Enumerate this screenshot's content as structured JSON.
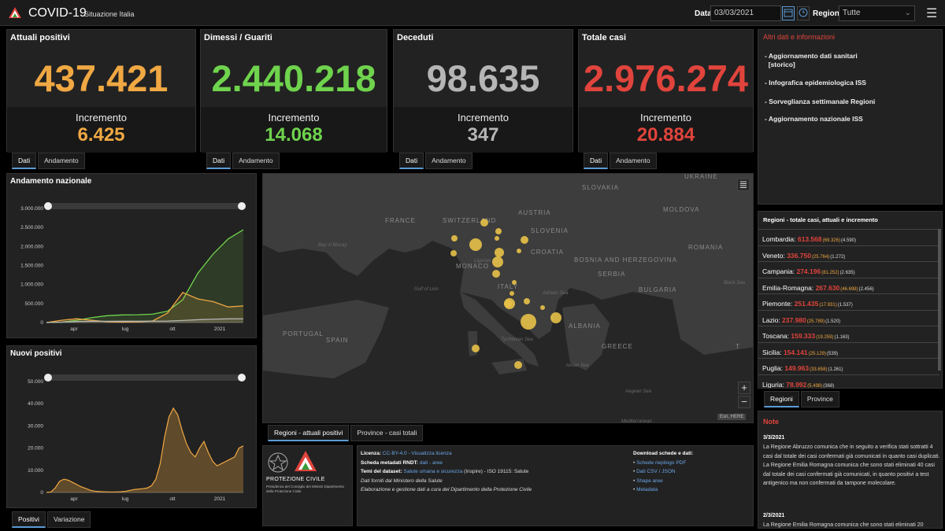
{
  "header": {
    "title": "COVID-19",
    "subtitle": "Situazione Italia",
    "date_label": "Data",
    "date_value": "03/03/2021",
    "region_label": "Regione",
    "region_value": "Tutte"
  },
  "kpis": [
    {
      "title": "Attuali positivi",
      "value": "437.421",
      "inc_label": "Incremento",
      "inc_value": "6.425",
      "color": "#f0a843"
    },
    {
      "title": "Dimessi / Guariti",
      "value": "2.440.218",
      "inc_label": "Incremento",
      "inc_value": "14.068",
      "color": "#6fd34d"
    },
    {
      "title": "Deceduti",
      "value": "98.635",
      "inc_label": "Incremento",
      "inc_value": "347",
      "color": "#b5b5b5"
    },
    {
      "title": "Totale casi",
      "value": "2.976.274",
      "inc_label": "Incremento",
      "inc_value": "20.884",
      "color": "#e0443c"
    }
  ],
  "kpi_tabs": {
    "dati": "Dati",
    "andamento": "Andamento"
  },
  "chart_nazionale": {
    "title": "Andamento nazionale",
    "yticks": [
      "3.000.000",
      "2.500.000",
      "2.000.000",
      "1.500.000",
      "1.000.000",
      "500.000",
      "0"
    ],
    "xticks": [
      "apr",
      "lug",
      "ott",
      "2021"
    ]
  },
  "chart_nuovi": {
    "title": "Nuovi positivi",
    "yticks": [
      "50.000",
      "40.000",
      "30.000",
      "20.000",
      "10.000",
      "0"
    ],
    "xticks": [
      "apr",
      "lug",
      "ott",
      "2021"
    ],
    "tabs": [
      "Positivi",
      "Variazione"
    ]
  },
  "chart_data": [
    {
      "type": "line",
      "title": "Andamento nazionale",
      "x": [
        "2020-02",
        "2020-03",
        "2020-04",
        "2020-05",
        "2020-06",
        "2020-07",
        "2020-08",
        "2020-09",
        "2020-10",
        "2020-11",
        "2020-12",
        "2021-01",
        "2021-02",
        "2021-03"
      ],
      "series": [
        {
          "color": "#6fd34d",
          "values": [
            0,
            10000,
            60000,
            130000,
            180000,
            200000,
            205000,
            220000,
            300000,
            600000,
            1300000,
            1800000,
            2200000,
            2440218
          ]
        },
        {
          "color": "#f0a843",
          "values": [
            0,
            60000,
            100000,
            60000,
            20000,
            12000,
            15000,
            40000,
            250000,
            790000,
            620000,
            550000,
            410000,
            437421
          ]
        },
        {
          "color": "#b5b5b5",
          "values": [
            0,
            10000,
            28000,
            33000,
            34000,
            35000,
            35500,
            36000,
            39000,
            55000,
            74000,
            88000,
            97000,
            98635
          ]
        }
      ],
      "ylim": [
        0,
        3000000
      ],
      "xticks": [
        "apr",
        "lug",
        "ott",
        "2021"
      ]
    },
    {
      "type": "area",
      "title": "Nuovi positivi",
      "color": "#f0a843",
      "values": [
        0,
        200,
        2000,
        5000,
        6000,
        5500,
        4500,
        3500,
        2500,
        1800,
        1000,
        600,
        400,
        300,
        250,
        200,
        250,
        300,
        500,
        900,
        1300,
        1500,
        1700,
        2000,
        3000,
        6000,
        13000,
        25000,
        34000,
        38000,
        35000,
        28000,
        22000,
        18000,
        16000,
        20000,
        23000,
        18000,
        14000,
        12000,
        13000,
        14000,
        15000,
        16000,
        20000,
        21000
      ],
      "ylim": [
        0,
        50000
      ],
      "xticks": [
        "apr",
        "lug",
        "ott",
        "2021"
      ]
    }
  ],
  "map": {
    "tabs": [
      "Regioni - attuali positivi",
      "Province - casi totali"
    ],
    "attribution": "Esri, HERE",
    "countries": [
      "FRANCE",
      "SWITZERLAND",
      "AUSTRIA",
      "SLOVAKIA",
      "UKRAINE",
      "MOLDOVA",
      "SLOVENIA",
      "CROATIA",
      "BOSNIA AND HERZEGOVINA",
      "SERBIA",
      "ROMANIA",
      "BULGARIA",
      "ITALY",
      "MONACO",
      "ALBANIA",
      "GREECE",
      "SPAIN",
      "PORTUGAL",
      "T"
    ],
    "seas": [
      "Bay of Biscay",
      "Gulf of Lion",
      "Ligurian Sea",
      "Adriatic Sea",
      "Tyrrhenian Sea",
      "Ionian Sea",
      "Black Sea",
      "Aegean Sea",
      "Mediterranean"
    ]
  },
  "info": {
    "title": "Altri dati e informazioni",
    "items": [
      "Aggiornamento dati sanitari",
      "[storico]",
      "Infografica epidemiologica ISS",
      "Sorveglianza settimanale Regioni",
      "Aggiornamento nazionale ISS"
    ]
  },
  "regions": {
    "title": "Regioni - totale casi, attuali e incremento",
    "tabs": [
      "Regioni",
      "Province"
    ],
    "rows": [
      {
        "name": "Lombardia: ",
        "total": "613.568",
        "current": "(69.326)",
        "inc": "(4.590)"
      },
      {
        "name": "Veneto: ",
        "total": "336.750",
        "current": "(25.764)",
        "inc": "(1.272)"
      },
      {
        "name": "Campania: ",
        "total": "274.196",
        "current": "(81.252)",
        "inc": "(2.635)"
      },
      {
        "name": "Emilia-Romagna: ",
        "total": "267.630",
        "current": "(46.698)",
        "inc": "(2.456)"
      },
      {
        "name": "Piemonte: ",
        "total": "251.435",
        "current": "(17.931)",
        "inc": "(1.537)"
      },
      {
        "name": "Lazio: ",
        "total": "237.980",
        "current": "(25.789)",
        "inc": "(1.520)"
      },
      {
        "name": "Toscana: ",
        "total": "159.333",
        "current": "(19.259)",
        "inc": "(1.163)"
      },
      {
        "name": "Sicilia: ",
        "total": "154.141",
        "current": "(25.129)",
        "inc": "(539)"
      },
      {
        "name": "Puglia: ",
        "total": "149.963",
        "current": "(33.658)",
        "inc": "(1.261)"
      },
      {
        "name": "Liguria: ",
        "total": "78.992",
        "current": "(5.498)",
        "inc": "(368)"
      }
    ]
  },
  "notes": {
    "title": "Note",
    "date1": "3/3/2021",
    "text1": "La Regione Abruzzo comunica che in seguito a verifica stati sottratti 4 casi dal totale dei casi confermati già comunicati in quanto casi duplicati. La Regione Emilia Romagna comunica che sono stati eliminati 40 casi dal totale dei casi confermati già comunicati, in quanto positivi a test antigenico ma non confermati da tampone molecolare.",
    "date2": "2/3/2021",
    "text2": "La Regione Emilia Romagna comunica che sono stati eliminati 20"
  },
  "footer": {
    "logo_text": "PROTEZIONE CIVILE",
    "logo_sub": "Presidenza del Consiglio dei Ministri Dipartimento della Protezione Civile",
    "licenza_label": "Licenza: ",
    "licenza_val": "CC-BY-4.0",
    "licenza_link": " - Visualizza licenza",
    "scheda_label": "Scheda metadati RNDT: ",
    "scheda_link": "dati - aree",
    "temi_label": "Temi del dataset: ",
    "temi_link": "Salute umana e sicurezza",
    "temi_rest": " (Inspire) - ISO 19115: Salute",
    "fonte": "Dati forniti dal Ministero della Salute",
    "elab": "Elaborazione e gestione dati a cura del Dipartimento della Protezione Civile",
    "download_title": "Download schede e dati:",
    "downloads": [
      "Schede riepilogo PDF",
      "Dati CSV / JSON",
      "Shape aree",
      "Metadata"
    ]
  }
}
